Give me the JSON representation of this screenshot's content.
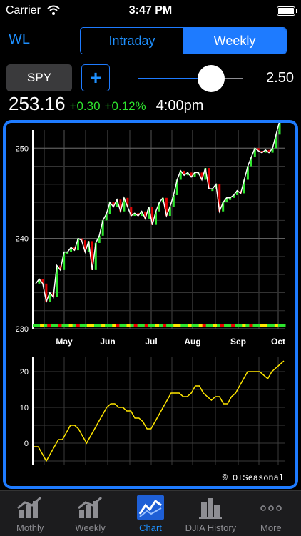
{
  "status": {
    "carrier": "Carrier",
    "time": "3:47 PM"
  },
  "header": {
    "left_button": "WL",
    "segments": [
      {
        "label": "Intraday",
        "selected": false
      },
      {
        "label": "Weekly",
        "selected": true
      }
    ],
    "accent_color": "#1e7bff"
  },
  "controls": {
    "symbol": "SPY",
    "add_label": "+",
    "slider_value": "2.50",
    "slider_level": 0.7
  },
  "quote": {
    "price": "253.16",
    "change": "+0.30",
    "change_pct": "+0.12%",
    "time": "4:00pm",
    "change_color": "#2ee62e"
  },
  "chart_data": [
    {
      "type": "line",
      "x_tick_labels": [
        "May",
        "Jun",
        "Jul",
        "Aug",
        "Sep",
        "Oct"
      ],
      "y_tick_labels": [
        "230",
        "240",
        "250"
      ],
      "ylim": [
        230,
        252
      ],
      "series": [
        {
          "values": [
            235,
            235.5,
            235,
            233,
            234,
            233.5,
            237,
            236.5,
            238.5,
            238.5,
            239,
            238.7,
            240,
            239.8,
            238.5,
            239.7,
            236.5,
            239.5,
            240.3,
            242,
            242.7,
            244,
            243.5,
            244.3,
            243,
            244.5,
            243.5,
            242.5,
            242.8,
            242.5,
            243,
            242.2,
            243.5,
            241.5,
            243,
            244,
            244.5,
            242.5,
            243.5,
            244.8,
            246.5,
            247.5,
            247,
            247.3,
            246.8,
            247.3,
            247.3,
            246.5,
            247.8,
            245.5,
            245.5,
            246,
            243,
            244,
            244.5,
            244.5,
            244.8,
            245.3,
            245,
            246.5,
            248,
            249,
            250,
            249.7,
            249.5,
            249.8,
            249.5,
            250,
            251.5,
            253
          ]
        }
      ]
    },
    {
      "type": "line",
      "y_tick_labels": [
        "0",
        "10",
        "20"
      ],
      "ylim": [
        -6,
        24
      ],
      "series": [
        {
          "values": [
            -1,
            -1,
            -3,
            -5,
            -3,
            -1,
            1,
            1,
            3,
            5,
            5,
            4,
            2,
            0,
            2,
            4,
            6,
            8,
            10,
            11,
            11,
            10,
            10,
            9,
            9,
            7,
            7,
            6,
            4,
            4,
            6,
            8,
            10,
            12,
            14,
            14,
            14,
            13,
            13,
            14,
            16,
            16,
            14,
            13,
            12,
            13,
            13,
            11,
            11,
            13,
            14,
            16,
            18,
            20,
            20,
            20,
            20,
            19,
            18,
            20,
            21,
            22,
            23
          ]
        }
      ]
    }
  ],
  "watermark": "© OTSeasonal",
  "tabs": [
    {
      "label": "Mothly",
      "icon": "bar-chart-icon",
      "active": false
    },
    {
      "label": "Weekly",
      "icon": "bar-chart-icon",
      "active": false
    },
    {
      "label": "Chart",
      "icon": "line-chart-icon",
      "active": true
    },
    {
      "label": "DJIA History",
      "icon": "building-icon",
      "active": false
    },
    {
      "label": "More",
      "icon": "more-dots-icon",
      "active": false
    }
  ]
}
